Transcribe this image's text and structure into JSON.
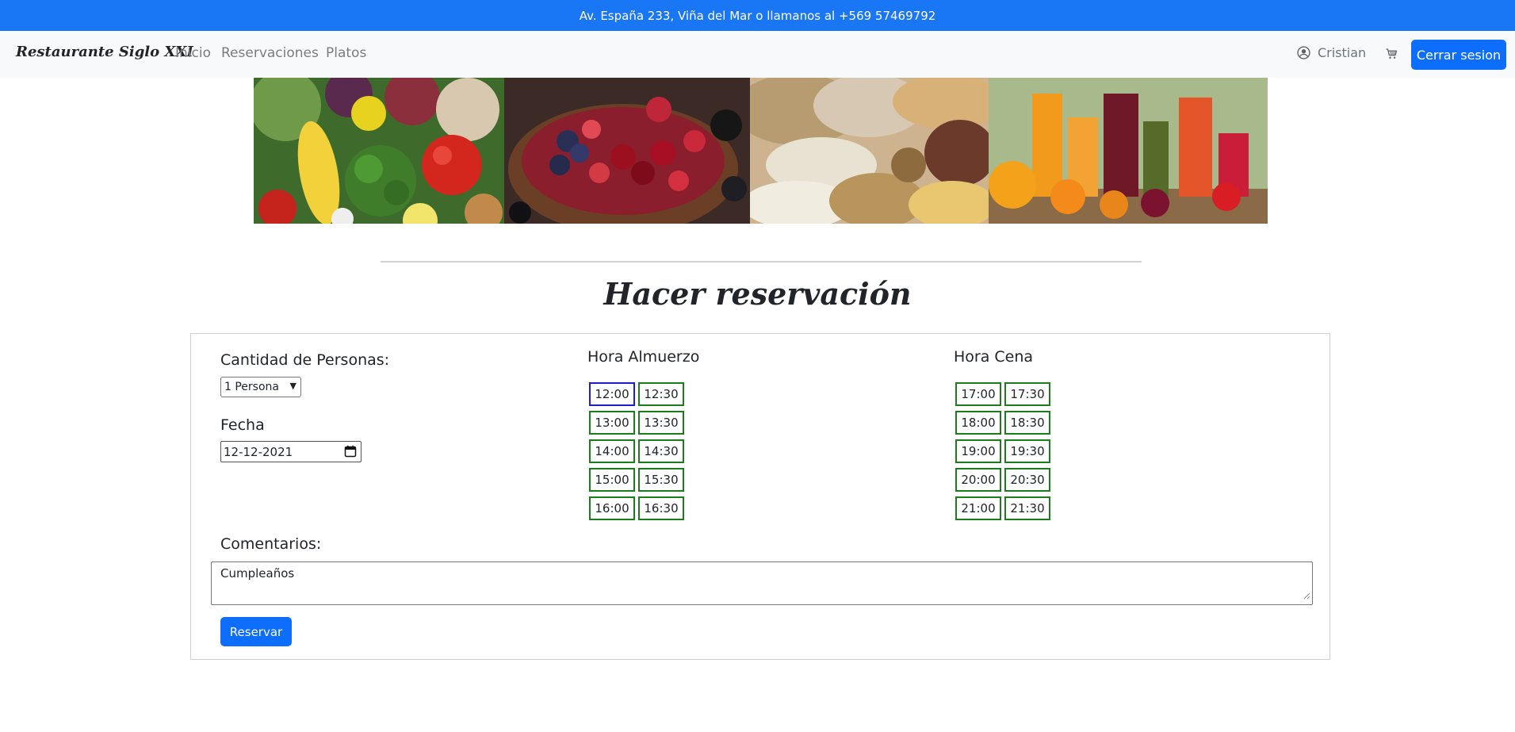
{
  "topbar": {
    "text": "Av. España 233, Viña del Mar o llamanos al +569 57469792"
  },
  "navbar": {
    "brand": "Restaurante Siglo XXI",
    "links": [
      "Inicio",
      "Reservaciones",
      "Platos"
    ],
    "user": {
      "icon": "user-circle-icon",
      "name": "Cristian"
    },
    "cart_icon": "cart-icon",
    "logout_label": "Cerrar sesion"
  },
  "banner": {
    "images": [
      "vegetables",
      "berries",
      "grains-and-legumes",
      "juices"
    ]
  },
  "page_title": "Hacer reservación",
  "form": {
    "people": {
      "label": "Cantidad de Personas:",
      "selected": "1 Persona"
    },
    "date": {
      "label": "Fecha",
      "value": "12-12-2021"
    },
    "lunch": {
      "label": "Hora Almuerzo",
      "slots": [
        "12:00",
        "12:30",
        "13:00",
        "13:30",
        "14:00",
        "14:30",
        "15:00",
        "15:30",
        "16:00",
        "16:30"
      ],
      "selected": "12:00"
    },
    "dinner": {
      "label": "Hora Cena",
      "slots": [
        "17:00",
        "17:30",
        "18:00",
        "18:30",
        "19:00",
        "19:30",
        "20:00",
        "20:30",
        "21:00",
        "21:30"
      ]
    },
    "comments": {
      "label": "Comentarios:",
      "value": "Cumpleaños"
    },
    "submit_label": "Reservar"
  },
  "colors": {
    "topbar": "#1976f5",
    "primary": "#0d6efd",
    "slot_border": "#1a7f1a",
    "slot_selected": "#1e1ec8"
  }
}
